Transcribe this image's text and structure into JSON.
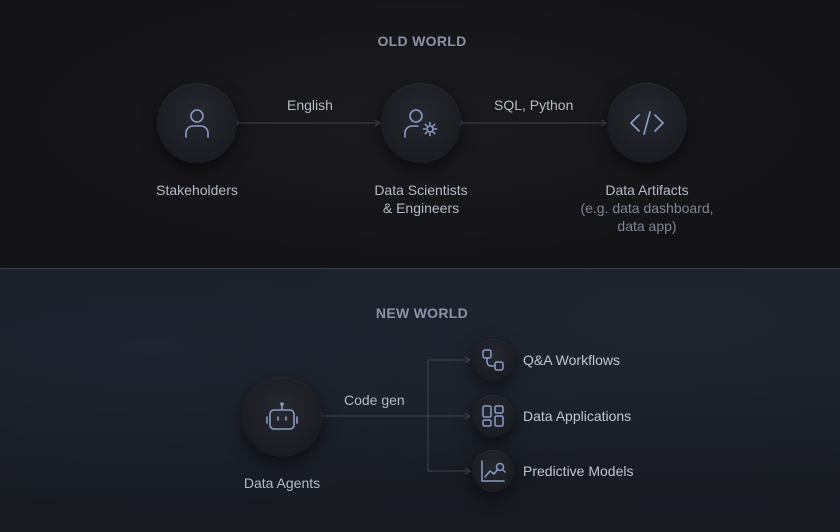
{
  "old_world": {
    "title": "OLD WORLD",
    "nodes": [
      {
        "label": "Stakeholders",
        "icon": "person-icon"
      },
      {
        "label_line1": "Data Scientists",
        "label_line2": "& Engineers",
        "icon": "person-gear-icon"
      },
      {
        "label": "Data Artifacts",
        "sub_line1": "(e.g. data dashboard,",
        "sub_line2": "data app)",
        "icon": "code-icon"
      }
    ],
    "edges": [
      {
        "label": "English"
      },
      {
        "label": "SQL, Python"
      }
    ]
  },
  "new_world": {
    "title": "NEW WORLD",
    "source": {
      "label": "Data Agents",
      "icon": "robot-icon"
    },
    "edge_label": "Code gen",
    "outputs": [
      {
        "label": "Q&A Workflows",
        "icon": "workflow-icon"
      },
      {
        "label": "Data Applications",
        "icon": "grid-icon"
      },
      {
        "label": "Predictive Models",
        "icon": "chart-icon"
      }
    ]
  },
  "colors": {
    "icon_stroke": "#8a9cc4",
    "line": "#3f434d",
    "title": "#8d93a6"
  }
}
